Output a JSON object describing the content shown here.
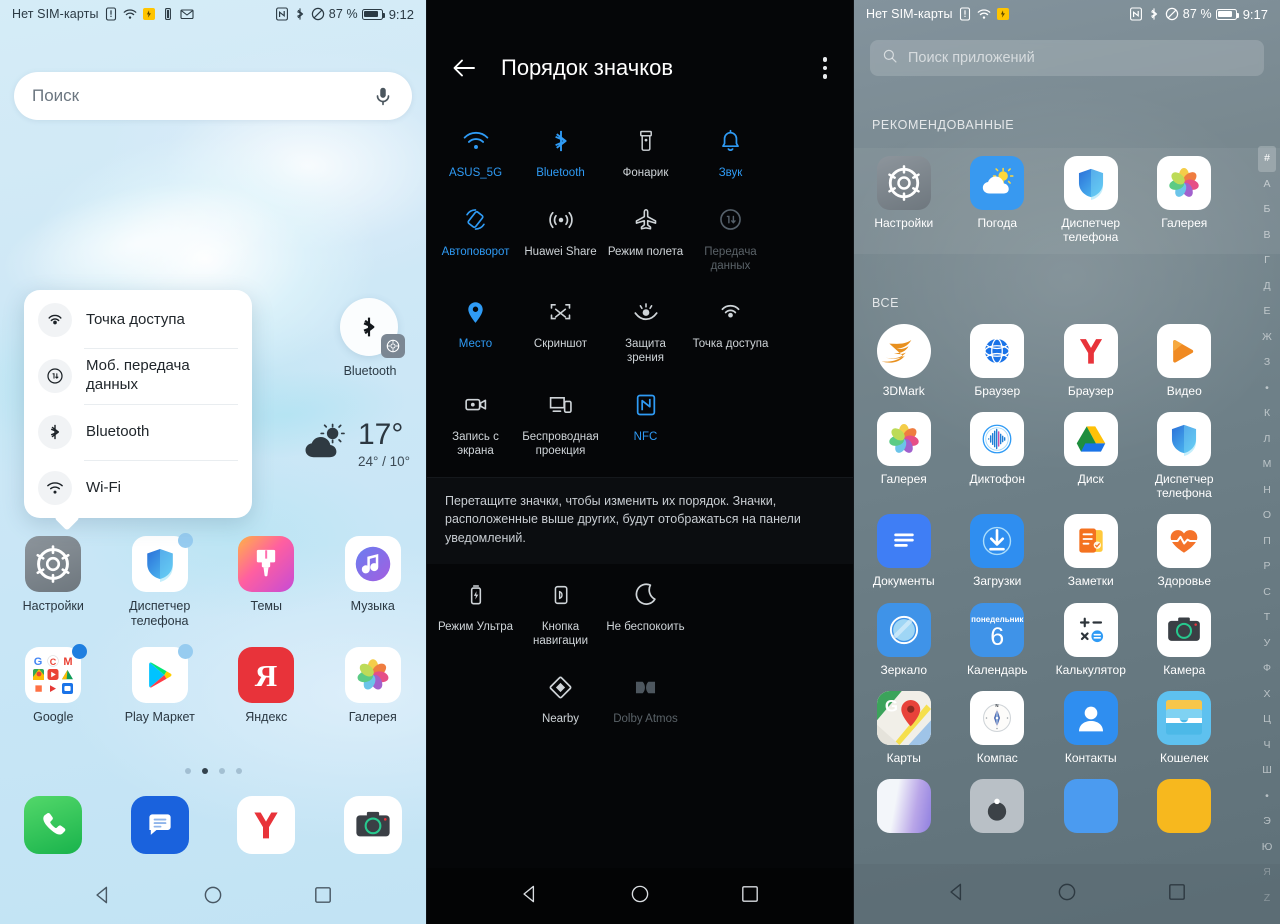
{
  "home": {
    "status": {
      "sim_text": "Нет SIM-карты",
      "battery_pct": "87 %",
      "time": "9:12",
      "icons": [
        "sim-alert-icon",
        "wifi-icon",
        "flashlight-on-icon",
        "battery-saver-icon",
        "mail-icon",
        "nfc-icon",
        "bluetooth-icon",
        "dnd-icon",
        "battery-icon"
      ]
    },
    "search": {
      "placeholder": "Поиск",
      "mic_icon": "microphone-icon"
    },
    "popup": {
      "items": [
        {
          "label": "Точка доступа",
          "icon": "hotspot-icon"
        },
        {
          "label": "Моб. передача данных",
          "icon": "mobile-data-icon"
        },
        {
          "label": "Bluetooth",
          "icon": "bluetooth-icon"
        },
        {
          "label": "Wi-Fi",
          "icon": "wifi-icon"
        }
      ]
    },
    "bluetooth_shortcut": {
      "label": "Bluetooth",
      "icon": "bluetooth-icon",
      "badge_icon": "settings-gear-icon"
    },
    "weather": {
      "temp": "17°",
      "range": "24° / 10°",
      "icon": "cloud-sun-icon"
    },
    "apps": [
      [
        {
          "name": "Настройки",
          "icon": "settings-gear-icon",
          "badge": ""
        },
        {
          "name": "Диспетчер телефона",
          "icon": "shield-icon",
          "badge": "light"
        },
        {
          "name": "Темы",
          "icon": "brush-icon",
          "badge": ""
        },
        {
          "name": "Музыка",
          "icon": "music-note-icon",
          "badge": ""
        }
      ],
      [
        {
          "name": "Google",
          "icon": "google-folder-icon",
          "badge": "blue"
        },
        {
          "name": "Play Маркет",
          "icon": "play-store-icon",
          "badge": "light"
        },
        {
          "name": "Яндекс",
          "icon": "yandex-icon",
          "badge": ""
        },
        {
          "name": "Галерея",
          "icon": "gallery-flower-icon",
          "badge": ""
        }
      ]
    ],
    "pager": {
      "count": 4,
      "active": 1
    },
    "dock": [
      {
        "name": "",
        "icon": "phone-icon"
      },
      {
        "name": "",
        "icon": "messages-icon"
      },
      {
        "name": "",
        "icon": "yandex-browser-icon"
      },
      {
        "name": "",
        "icon": "camera-icon"
      }
    ],
    "nav": {
      "back": "back-triangle-icon",
      "home": "home-circle-icon",
      "recents": "recents-square-icon"
    }
  },
  "order": {
    "title": "Порядок значков",
    "back_icon": "arrow-left-icon",
    "menu_icon": "more-vertical-icon",
    "hint": "Перетащите значки, чтобы изменить их порядок. Значки, расположенные выше других, будут отображаться на панели уведомлений.",
    "toggles_top": [
      {
        "label": "ASUS_5G",
        "icon": "wifi-icon",
        "state": "on"
      },
      {
        "label": "Bluetooth",
        "icon": "bluetooth-icon",
        "state": "on"
      },
      {
        "label": "Фонарик",
        "icon": "flashlight-icon",
        "state": "neutral"
      },
      {
        "label": "Звук",
        "icon": "bell-icon",
        "state": "on"
      },
      {
        "label": "Автоповорот",
        "icon": "auto-rotate-icon",
        "state": "on"
      },
      {
        "label": "Huawei Share",
        "icon": "huawei-share-icon",
        "state": "neutral"
      },
      {
        "label": "Режим полета",
        "icon": "airplane-icon",
        "state": "neutral"
      },
      {
        "label": "Передача данных",
        "icon": "mobile-data-icon",
        "state": "off"
      },
      {
        "label": "Место",
        "icon": "location-pin-icon",
        "state": "on"
      },
      {
        "label": "Скриншот",
        "icon": "screenshot-icon",
        "state": "neutral"
      },
      {
        "label": "Защита зрения",
        "icon": "eye-comfort-icon",
        "state": "neutral"
      },
      {
        "label": "Точка доступа",
        "icon": "hotspot-icon",
        "state": "neutral"
      },
      {
        "label": "Запись с экрана",
        "icon": "screen-record-icon",
        "state": "neutral"
      },
      {
        "label": "Беспроводная проекция",
        "icon": "wireless-projection-icon",
        "state": "neutral"
      },
      {
        "label": "NFC",
        "icon": "nfc-icon",
        "state": "on"
      }
    ],
    "toggles_bottom": [
      {
        "label": "Режим Ультра",
        "icon": "ultra-battery-icon",
        "state": "neutral"
      },
      {
        "label": "Кнопка навигации",
        "icon": "nav-button-icon",
        "state": "neutral"
      },
      {
        "label": "Не беспокоить",
        "icon": "moon-icon",
        "state": "neutral"
      },
      {
        "label": "Nearby",
        "icon": "nearby-icon",
        "state": "neutral"
      },
      {
        "label": "Dolby Atmos",
        "icon": "dolby-atmos-icon",
        "state": "off"
      }
    ],
    "nav": {
      "back": "back-triangle-icon",
      "home": "home-circle-icon",
      "recents": "recents-square-icon"
    }
  },
  "drawer": {
    "status": {
      "sim_text": "Нет SIM-карты",
      "battery_pct": "87 %",
      "time": "9:17"
    },
    "search": {
      "placeholder": "Поиск приложений",
      "icon": "search-icon"
    },
    "section_recommended": "РЕКОМЕНДОВАННЫЕ",
    "section_all": "ВСЕ",
    "recommended": [
      {
        "name": "Настройки",
        "icon": "settings-gear-icon"
      },
      {
        "name": "Погода",
        "icon": "weather-icon"
      },
      {
        "name": "Диспетчер телефона",
        "icon": "shield-icon"
      },
      {
        "name": "Галерея",
        "icon": "gallery-flower-icon"
      }
    ],
    "all_apps": [
      [
        {
          "name": "3DMark",
          "icon": "3dmark-icon"
        },
        {
          "name": "Браузер",
          "icon": "huawei-browser-icon"
        },
        {
          "name": "Браузер",
          "icon": "yandex-browser-icon"
        },
        {
          "name": "Видео",
          "icon": "video-play-icon"
        }
      ],
      [
        {
          "name": "Галерея",
          "icon": "gallery-flower-icon"
        },
        {
          "name": "Диктофон",
          "icon": "voice-recorder-icon"
        },
        {
          "name": "Диск",
          "icon": "google-drive-icon"
        },
        {
          "name": "Диспетчер телефона",
          "icon": "shield-icon"
        }
      ],
      [
        {
          "name": "Документы",
          "icon": "documents-icon"
        },
        {
          "name": "Загрузки",
          "icon": "downloads-icon"
        },
        {
          "name": "Заметки",
          "icon": "notes-icon"
        },
        {
          "name": "Здоровье",
          "icon": "health-heart-icon"
        }
      ],
      [
        {
          "name": "Зеркало",
          "icon": "mirror-icon"
        },
        {
          "name": "Календарь",
          "icon": "calendar-icon",
          "day_label": "понедельник",
          "day_number": "6"
        },
        {
          "name": "Калькулятор",
          "icon": "calculator-icon"
        },
        {
          "name": "Камера",
          "icon": "camera-icon"
        }
      ],
      [
        {
          "name": "Карты",
          "icon": "google-maps-icon"
        },
        {
          "name": "Компас",
          "icon": "compass-icon"
        },
        {
          "name": "Контакты",
          "icon": "contacts-icon"
        },
        {
          "name": "Кошелек",
          "icon": "wallet-icon"
        }
      ]
    ],
    "alphabet": [
      "#",
      "А",
      "Б",
      "В",
      "Г",
      "Д",
      "Е",
      "Ж",
      "З",
      "•",
      "К",
      "Л",
      "М",
      "Н",
      "О",
      "П",
      "Р",
      "С",
      "Т",
      "У",
      "Ф",
      "Х",
      "Ц",
      "Ч",
      "Ш",
      "•",
      "Э",
      "Ю",
      "Я",
      "Z"
    ],
    "alphabet_selected": "#",
    "nav": {
      "back": "back-triangle-icon",
      "home": "home-circle-icon",
      "recents": "recents-square-icon"
    }
  },
  "colors": {
    "accent_blue": "#2f9bf5",
    "home_bg": "#c8e6f6",
    "drawer_bg": "#6e8088",
    "dark_bg": "#050608",
    "yellow": "#ffc400",
    "red": "#e8333a"
  }
}
